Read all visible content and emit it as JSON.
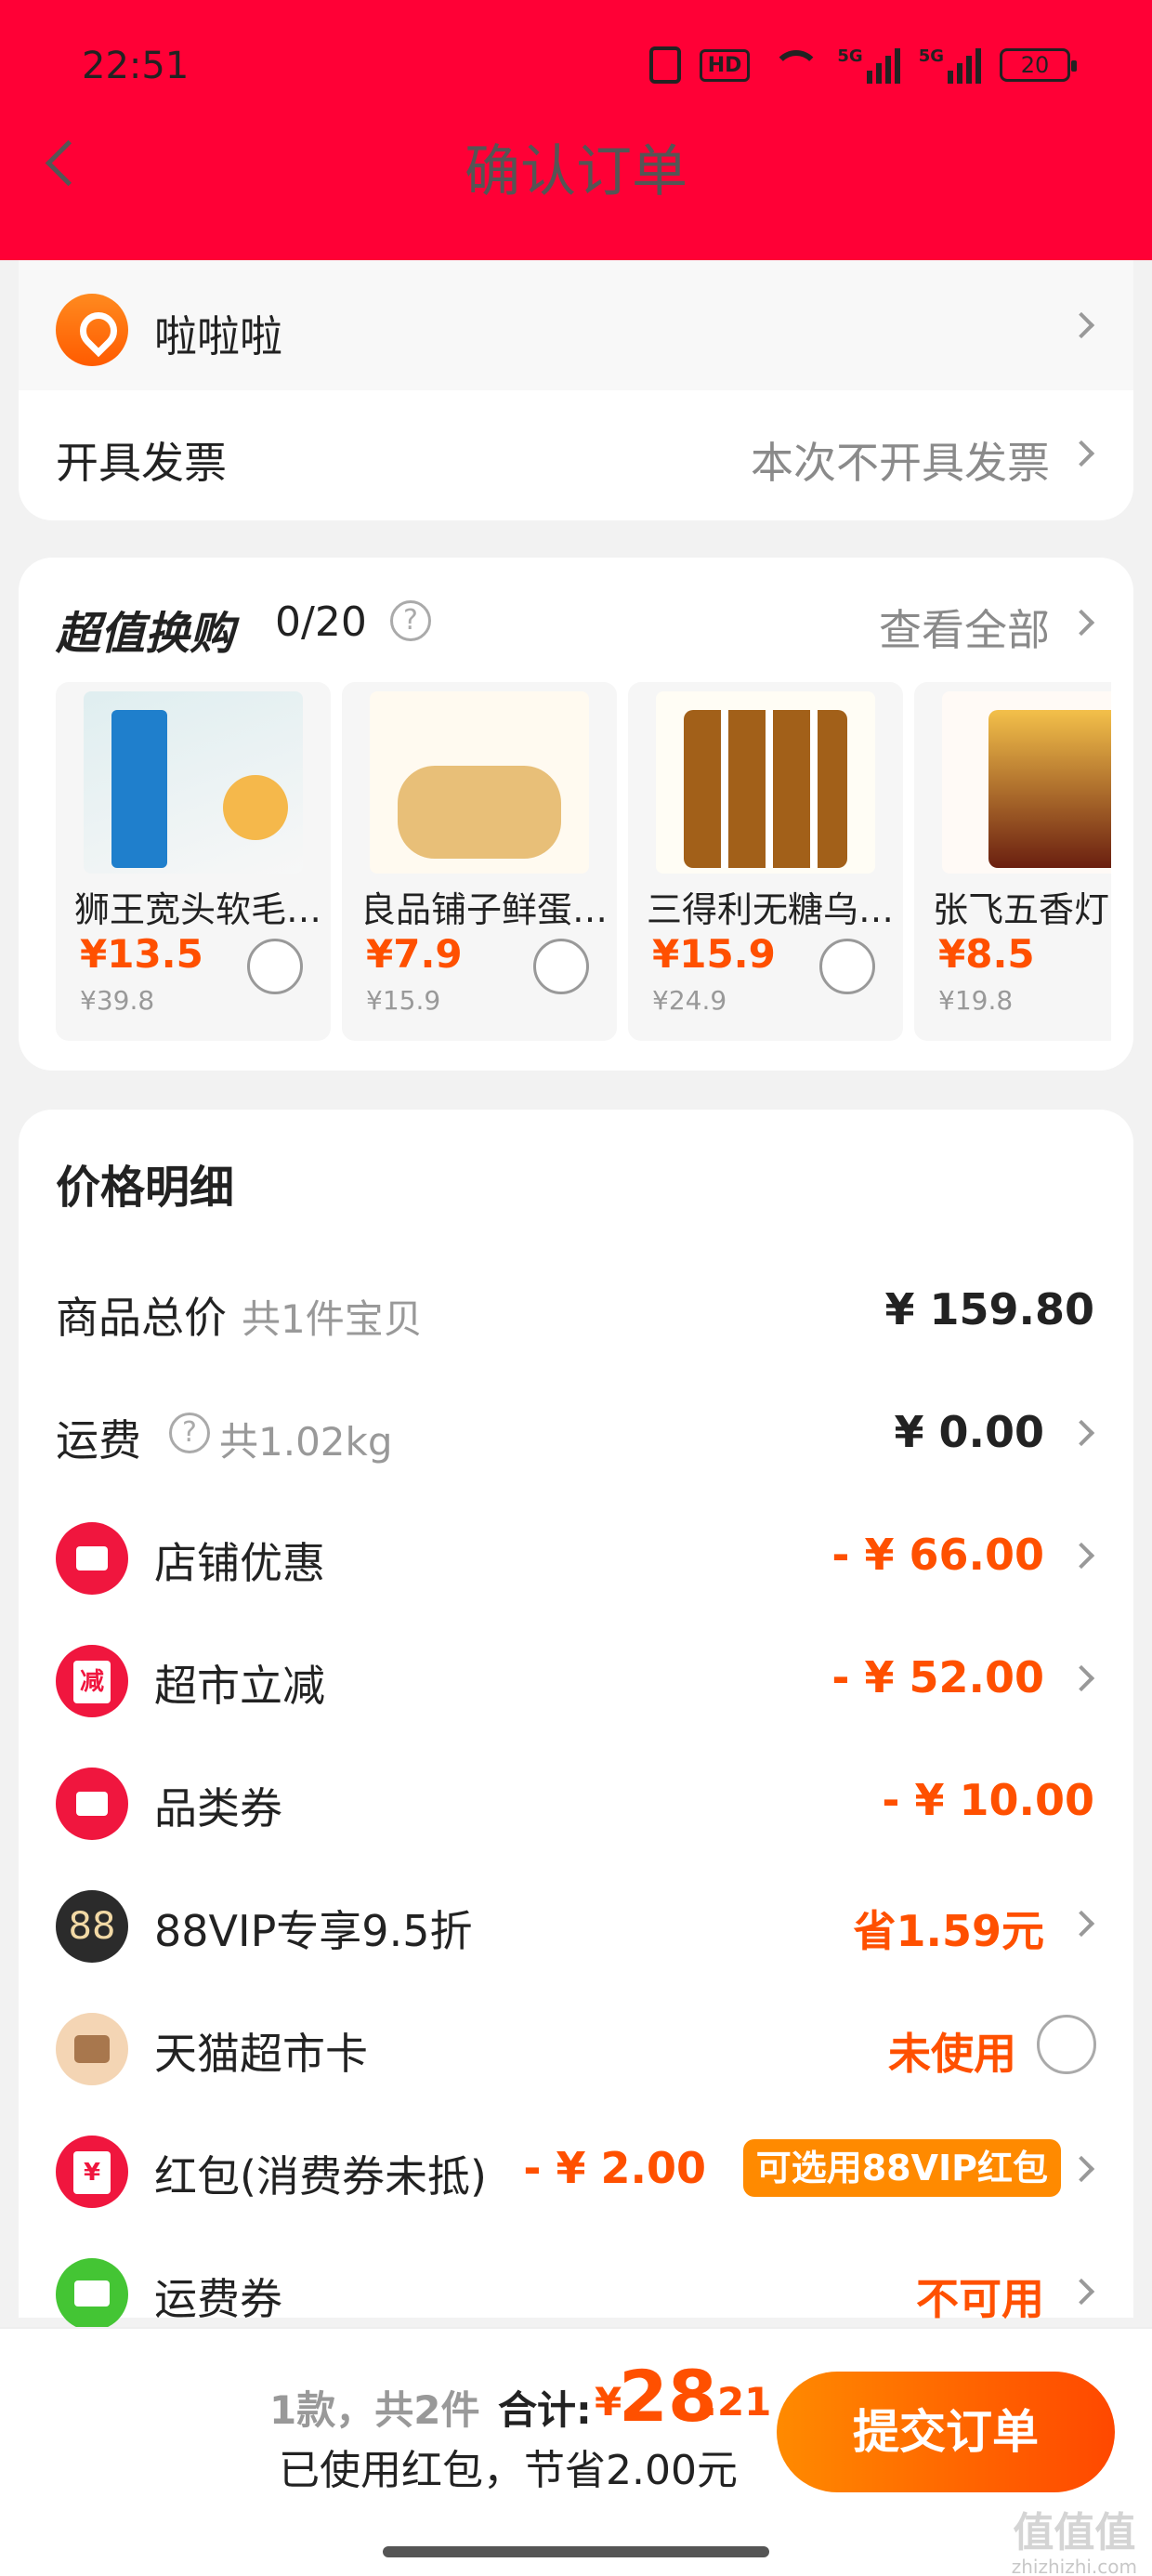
{
  "status_bar": {
    "time": "22:51",
    "icons": [
      "nfc-icon",
      "hd-icon",
      "wifi-icon",
      "5g-signal-icon",
      "5g-signal-icon",
      "battery-icon"
    ],
    "hd": "HD",
    "net1": "5G",
    "net2": "5G",
    "battery": "20"
  },
  "header": {
    "title": "确认订单"
  },
  "address": {
    "name": "啦啦啦"
  },
  "invoice": {
    "label": "开具发票",
    "value": "本次不开具发票"
  },
  "deals": {
    "title": "超值换购",
    "count": "0/20",
    "help": "?",
    "view_all": "查看全部",
    "products": [
      {
        "name": "狮王宽头软毛牙刷",
        "price": "¥13.5",
        "original": "¥39.8",
        "image": "toothbrush"
      },
      {
        "name": "良品铺子鲜蛋沙琪玛",
        "price": "¥7.9",
        "original": "¥15.9",
        "image": "cake"
      },
      {
        "name": "三得利无糖乌龙茶",
        "price": "¥15.9",
        "original": "¥24.9",
        "image": "oolong-tea"
      },
      {
        "name": "张飞五香灯影牛肉",
        "price": "¥8.5",
        "original": "¥19.8",
        "image": "beef"
      }
    ]
  },
  "price_details": {
    "title": "价格明细",
    "goods": {
      "label": "商品总价",
      "sub": "共1件宝贝",
      "value": "¥ 159.80"
    },
    "shipping": {
      "label": "运费",
      "help": "?",
      "sub": "共1.02kg",
      "value": "¥ 0.00"
    },
    "shop_discount": {
      "label": "店铺优惠",
      "value": "- ¥ 66.00"
    },
    "supermarket_discount": {
      "label": "超市立减",
      "icon_text": "减",
      "value": "- ¥ 52.00"
    },
    "category_coupon": {
      "label": "品类券",
      "value": "- ¥ 10.00"
    },
    "vip": {
      "label": "88VIP专享9.5折",
      "icon_text": "88",
      "value": "省1.59元"
    },
    "tmall_card": {
      "label": "天猫超市卡",
      "value": "未使用"
    },
    "hongbao": {
      "label": "红包(消费券未抵)",
      "icon_text": "¥",
      "value": "- ¥ 2.00",
      "badge": "可选用88VIP红包"
    },
    "shipping_coupon": {
      "label": "运费券",
      "value": "不可用"
    }
  },
  "bottom": {
    "count": "1款，共2件",
    "total_label": "合计:",
    "currency": "¥",
    "total_int": "28",
    "total_dec": ".21",
    "saved": "已使用红包，节省2.00元",
    "submit": "提交订单"
  },
  "watermark": {
    "line1": "值值值",
    "line2": "zhizhizhi.com"
  },
  "colors": {
    "header_red": "#ff0036",
    "accent_orange": "#ff5000",
    "badge_orange": "#ff8a00"
  }
}
